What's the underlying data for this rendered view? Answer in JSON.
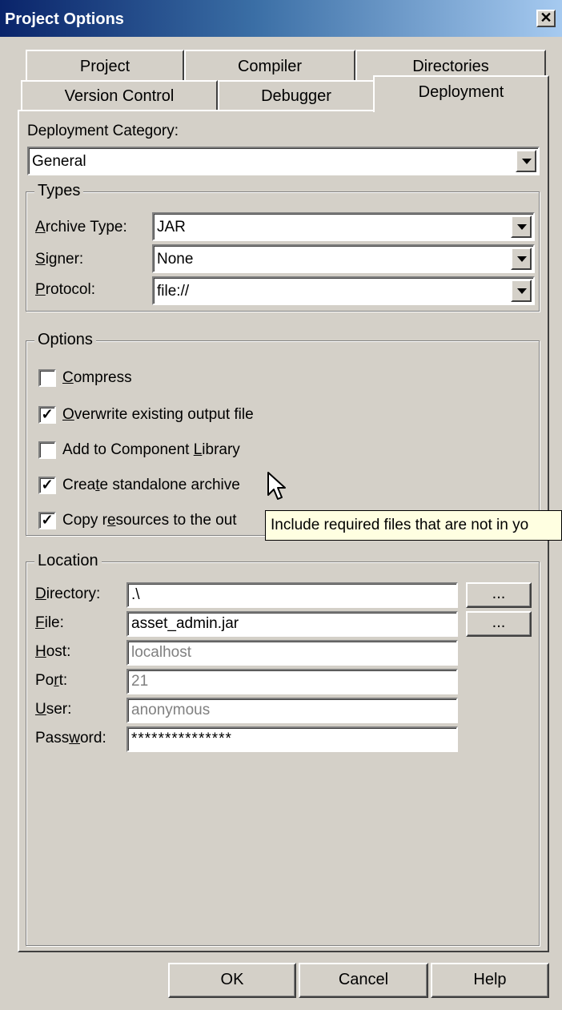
{
  "window": {
    "title": "Project Options",
    "close_glyph": "✕"
  },
  "tabs_back": [
    {
      "label": "Project"
    },
    {
      "label": "Compiler"
    },
    {
      "label": "Directories"
    }
  ],
  "tabs_front": [
    {
      "label": "Version Control"
    },
    {
      "label": "Debugger"
    },
    {
      "label": "Deployment",
      "active": true
    }
  ],
  "deployment": {
    "category_label": "Deployment Category:",
    "category_value": "General",
    "types": {
      "title": "Types",
      "archive_type_label": "Archive Type:",
      "archive_type_value": "JAR",
      "signer_label": "Signer:",
      "signer_value": "None",
      "protocol_label": "Protocol:",
      "protocol_value": "file://"
    },
    "options": {
      "title": "Options",
      "items": [
        {
          "label": "Compress",
          "checked": false
        },
        {
          "label": "Overwrite existing output file",
          "checked": true
        },
        {
          "label": "Add to Component Library",
          "checked": false
        },
        {
          "label": "Create standalone archive",
          "checked": true
        },
        {
          "label": "Copy resources to the out",
          "checked": true
        }
      ],
      "check_glyph": "✓"
    },
    "tooltip": "Include required files that are not in yo",
    "location": {
      "title": "Location",
      "directory_label": "Directory:",
      "directory_value": ".\\",
      "file_label": "File:",
      "file_value": "asset_admin.jar",
      "host_label": "Host:",
      "host_value": "localhost",
      "port_label": "Port:",
      "port_value": "21",
      "user_label": "User:",
      "user_value": "anonymous",
      "password_label": "Password:",
      "password_value": "***************",
      "browse_label": "..."
    }
  },
  "buttons": {
    "ok": "OK",
    "cancel": "Cancel",
    "help": "Help"
  }
}
